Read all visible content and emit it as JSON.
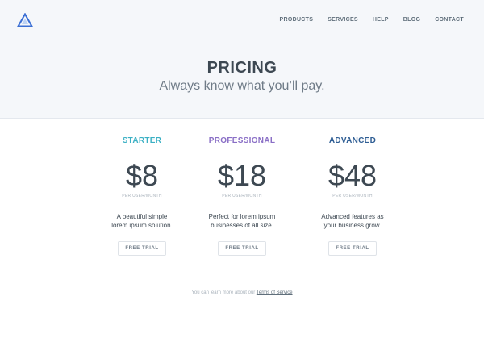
{
  "nav": {
    "logo_icon": "triangle-logo-icon",
    "items": [
      "PRODUCTS",
      "SERVICES",
      "HELP",
      "BLOG",
      "CONTACT"
    ]
  },
  "hero": {
    "title": "PRICING",
    "subtitle": "Always know what you’ll pay."
  },
  "plans": [
    {
      "name": "STARTER",
      "color": "#3bb0c4",
      "price": "$8",
      "unit": "PER USER/MONTH",
      "desc_line1": "A beautiful simple",
      "desc_line2": "lorem ipsum solution.",
      "cta": "FREE TRIAL"
    },
    {
      "name": "PROFESSIONAL",
      "color": "#8a6fc6",
      "price": "$18",
      "unit": "PER USER/MONTH",
      "desc_line1": "Perfect for lorem ipsum",
      "desc_line2": "businesses of all size.",
      "cta": "FREE TRIAL"
    },
    {
      "name": "ADVANCED",
      "color": "#2f5e94",
      "price": "$48",
      "unit": "PER USER/MONTH",
      "desc_line1": "Advanced features as",
      "desc_line2": "your business grow.",
      "cta": "FREE TRIAL"
    }
  ],
  "footer": {
    "text": "You can learn more about our",
    "link": "Terms of Service"
  },
  "colors": {
    "logo": "#3b6fd4",
    "hero_bg": "#f5f7fa"
  }
}
